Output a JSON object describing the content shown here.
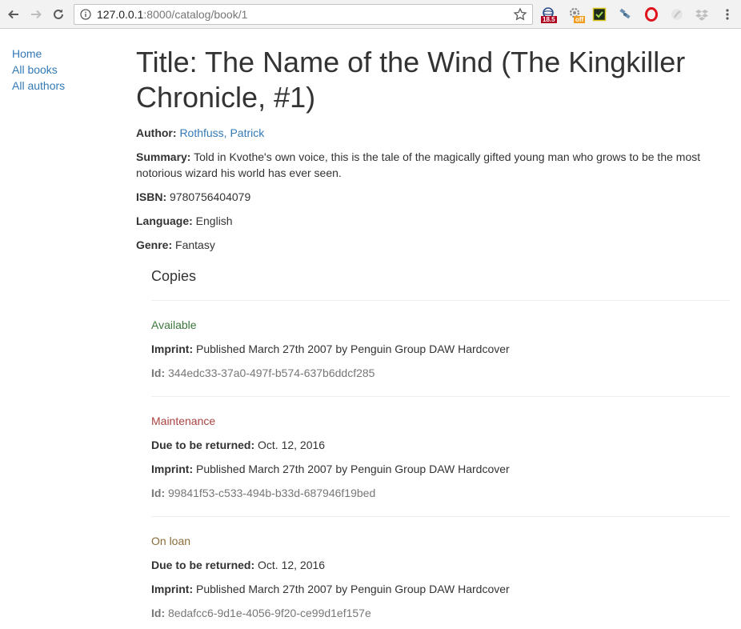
{
  "browser": {
    "url_host": "127.0.0.1",
    "url_rest": ":8000/catalog/book/1",
    "extensions": [
      {
        "name": "extension-1",
        "badge": "18.5",
        "badge_color": "#b00020"
      },
      {
        "name": "extension-2",
        "badge": "off",
        "badge_color": "#f29d1f"
      }
    ]
  },
  "sidebar": {
    "items": [
      {
        "label": "Home"
      },
      {
        "label": "All books"
      },
      {
        "label": "All authors"
      }
    ]
  },
  "book": {
    "title": "Title: The Name of the Wind (The Kingkiller Chronicle, #1)",
    "author_label": "Author:",
    "author": "Rothfuss, Patrick",
    "summary_label": "Summary:",
    "summary": "Told in Kvothe's own voice, this is the tale of the magically gifted young man who grows to be the most notorious wizard his world has ever seen.",
    "isbn_label": "ISBN:",
    "isbn": "9780756404079",
    "language_label": "Language:",
    "language": "English",
    "genre_label": "Genre:",
    "genre": "Fantasy"
  },
  "copies": {
    "heading": "Copies",
    "labels": {
      "due": "Due to be returned:",
      "imprint": "Imprint:",
      "id": "Id:"
    },
    "items": [
      {
        "status": "Available",
        "status_color": "#3c763d",
        "imprint": "Published March 27th 2007 by Penguin Group DAW Hardcover",
        "id": "344edc33-37a0-497f-b574-637b6ddcf285"
      },
      {
        "status": "Maintenance",
        "status_color": "#a94442",
        "due": "Oct. 12, 2016",
        "imprint": "Published March 27th 2007 by Penguin Group DAW Hardcover",
        "id": "99841f53-c533-494b-b33d-687946f19bed"
      },
      {
        "status": "On loan",
        "status_color": "#8a6d3b",
        "due": "Oct. 12, 2016",
        "imprint": "Published March 27th 2007 by Penguin Group DAW Hardcover",
        "id": "8edafcc6-9d1e-4056-9f20-ce99d1ef157e"
      }
    ]
  }
}
